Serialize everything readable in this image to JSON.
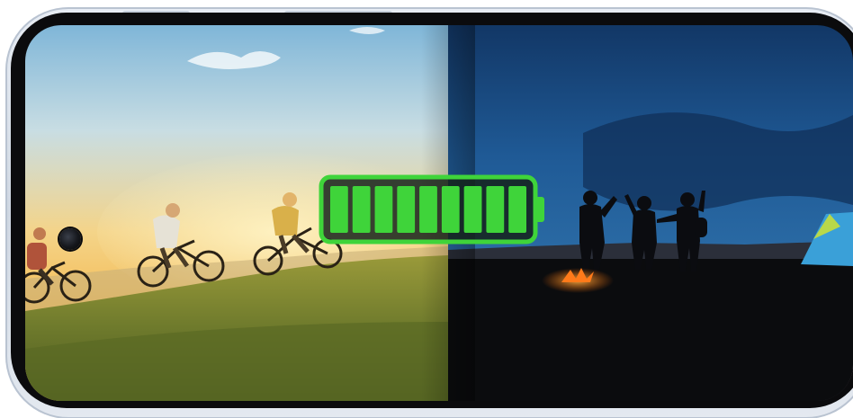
{
  "image": {
    "subject": "smartphone-display",
    "left_scene": "daytime-cyclists-on-hill",
    "right_scene": "night-campfire-silhouettes"
  },
  "battery": {
    "charge_fraction": 1.0,
    "segments_total": 9,
    "segments_filled": 9,
    "fill_color": "#3fd43a",
    "outline_color": "#3fd43a"
  },
  "colors": {
    "sky_day": "#f6c75a",
    "sky_night": "#1f4f86",
    "grass_day": "#6f7a2a",
    "ground_night": "#0a0b0c",
    "phone_frame": "#d5dde8"
  }
}
